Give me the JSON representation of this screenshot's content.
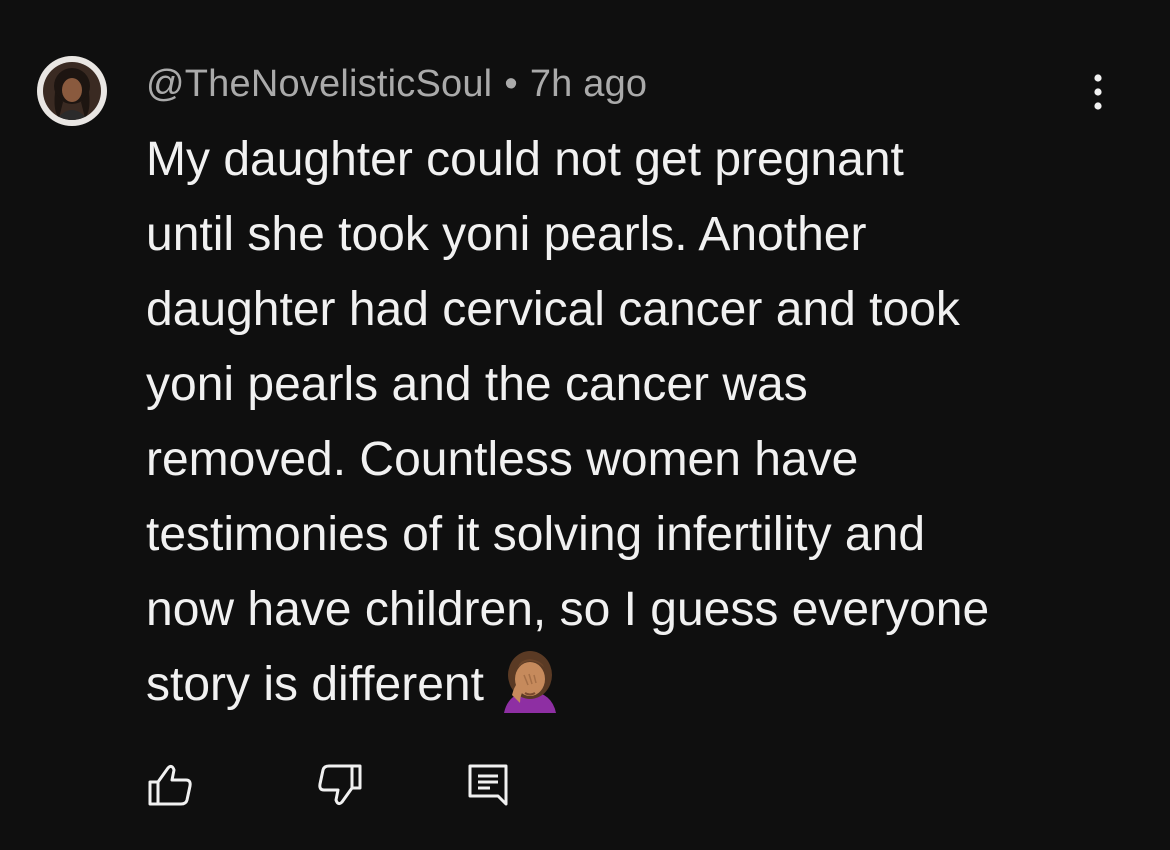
{
  "comment": {
    "author": "@TheNovelisticSoul",
    "separator": "•",
    "timestamp": "7h ago",
    "text_lines": [
      "My daughter could not get pregnant",
      "until she took yoni pearls. Another",
      "daughter had cervical cancer and took",
      "yoni pearls and the cancer was",
      "removed. Countless women have",
      "testimonies of it solving infertility and",
      "now have children, so I guess everyone",
      "story is different"
    ],
    "emoji": "woman-facepalming-emoji",
    "more_menu_icon": "more-vertical-icon"
  },
  "actions": {
    "like_icon": "thumbs-up-icon",
    "dislike_icon": "thumbs-down-icon",
    "reply_icon": "reply-comment-icon"
  },
  "colors": {
    "background": "#0f0f0f",
    "primary_text": "#f1f1f1",
    "secondary_text": "#aaaaaa"
  }
}
